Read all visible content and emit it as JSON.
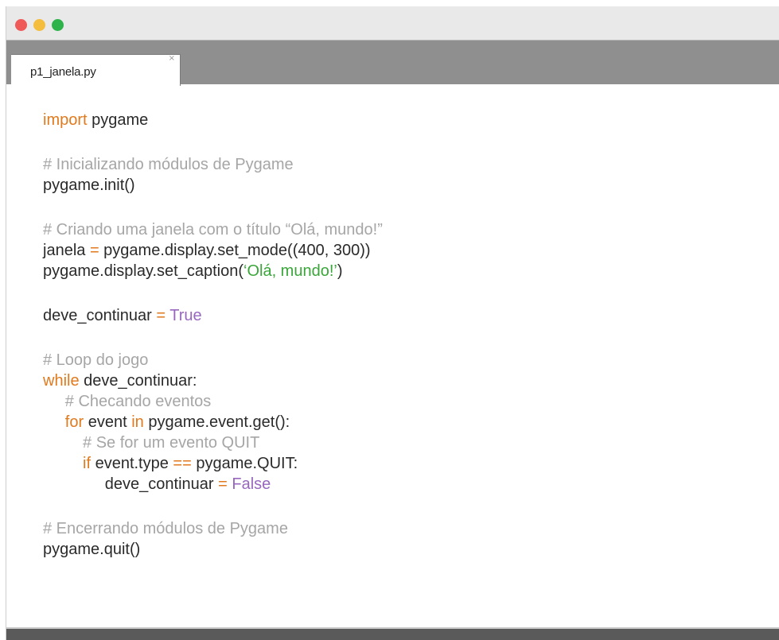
{
  "window": {
    "traffic_lights": [
      "#ef5957",
      "#f5bd3c",
      "#2eb34b"
    ]
  },
  "tab": {
    "label": "p1_janela.py",
    "close_glyph": "×"
  },
  "code": {
    "lines": [
      [
        {
          "t": "keyword",
          "v": "import"
        },
        {
          "t": "plain",
          "v": " pygame"
        }
      ],
      [],
      [
        {
          "t": "comment",
          "v": "# Inicializando módulos de Pygame"
        }
      ],
      [
        {
          "t": "plain",
          "v": "pygame.init()"
        }
      ],
      [],
      [
        {
          "t": "comment",
          "v": "# Criando uma janela com o título “Olá, mundo!”"
        }
      ],
      [
        {
          "t": "plain",
          "v": "janela "
        },
        {
          "t": "op",
          "v": "="
        },
        {
          "t": "plain",
          "v": " pygame.display.set_mode((400, 300))"
        }
      ],
      [
        {
          "t": "plain",
          "v": "pygame.display.set_caption("
        },
        {
          "t": "string",
          "v": "‘Olá, mundo!’"
        },
        {
          "t": "plain",
          "v": ")"
        }
      ],
      [],
      [
        {
          "t": "plain",
          "v": "deve_continuar "
        },
        {
          "t": "op",
          "v": "="
        },
        {
          "t": "plain",
          "v": " "
        },
        {
          "t": "constant",
          "v": "True"
        }
      ],
      [],
      [
        {
          "t": "comment",
          "v": "# Loop do jogo"
        }
      ],
      [
        {
          "t": "keyword",
          "v": "while"
        },
        {
          "t": "plain",
          "v": " deve_continuar:"
        }
      ],
      [
        {
          "t": "plain",
          "v": "     "
        },
        {
          "t": "comment",
          "v": "# Checando eventos"
        }
      ],
      [
        {
          "t": "plain",
          "v": "     "
        },
        {
          "t": "keyword",
          "v": "for"
        },
        {
          "t": "plain",
          "v": " event "
        },
        {
          "t": "keyword",
          "v": "in"
        },
        {
          "t": "plain",
          "v": " pygame.event.get():"
        }
      ],
      [
        {
          "t": "plain",
          "v": "         "
        },
        {
          "t": "comment",
          "v": "# Se for um evento QUIT"
        }
      ],
      [
        {
          "t": "plain",
          "v": "         "
        },
        {
          "t": "keyword",
          "v": "if"
        },
        {
          "t": "plain",
          "v": " event.type "
        },
        {
          "t": "op",
          "v": "=="
        },
        {
          "t": "plain",
          "v": " pygame.QUIT:"
        }
      ],
      [
        {
          "t": "plain",
          "v": "              deve_continuar "
        },
        {
          "t": "op",
          "v": "="
        },
        {
          "t": "plain",
          "v": " "
        },
        {
          "t": "constant",
          "v": "False"
        }
      ],
      [],
      [
        {
          "t": "comment",
          "v": "# Encerrando módulos de Pygame"
        }
      ],
      [
        {
          "t": "plain",
          "v": "pygame.quit()"
        }
      ]
    ]
  },
  "colors": {
    "keyword": "#e07a1f",
    "comment": "#a6a6a6",
    "string": "#3aa63a",
    "constant": "#9868c0",
    "plain": "#2a2a2a"
  }
}
